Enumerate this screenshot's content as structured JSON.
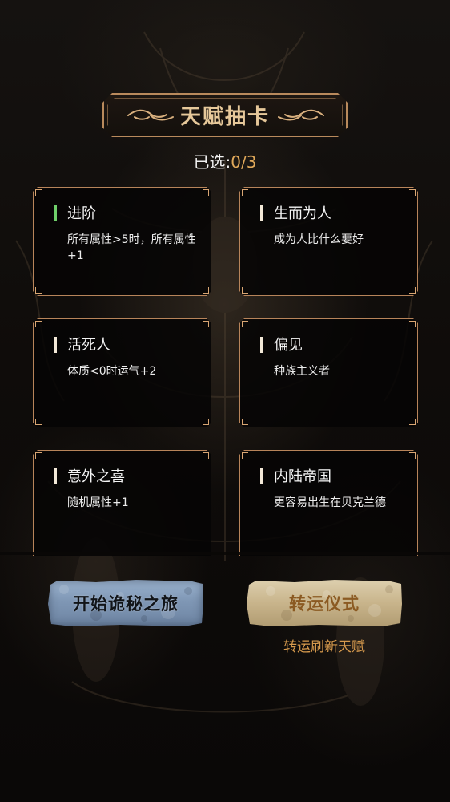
{
  "header": {
    "title": "天赋抽卡",
    "selected_label": "已选:",
    "selected_value": "0/3"
  },
  "talents": [
    {
      "name": "进阶",
      "desc": "所有属性>5时，所有属性+1",
      "marker": "green-bar"
    },
    {
      "name": "生而为人",
      "desc": "成为人比什么要好",
      "marker": "white-bar"
    },
    {
      "name": "活死人",
      "desc": "体质<0时运气+2",
      "marker": "white-bar"
    },
    {
      "name": "偏见",
      "desc": "种族主义者",
      "marker": "white-bar"
    },
    {
      "name": "意外之喜",
      "desc": "随机属性+1",
      "marker": "white-bar"
    },
    {
      "name": "内陆帝国",
      "desc": "更容易出生在贝克兰德",
      "marker": "white-bar"
    }
  ],
  "actions": {
    "start_label": "开始诡秘之旅",
    "fortune_label": "转运仪式",
    "fortune_caption": "转运刷新天赋"
  },
  "colors": {
    "frame_gold": "#b98a5c",
    "title_text": "#e6c89a",
    "count_accent": "#e1a95a",
    "green_marker": "#6fcf6a",
    "start_button": "#7f97b5",
    "fortune_button": "#c8b48b",
    "fortune_text": "#8b5a22",
    "caption_orange": "#d79a4d"
  }
}
